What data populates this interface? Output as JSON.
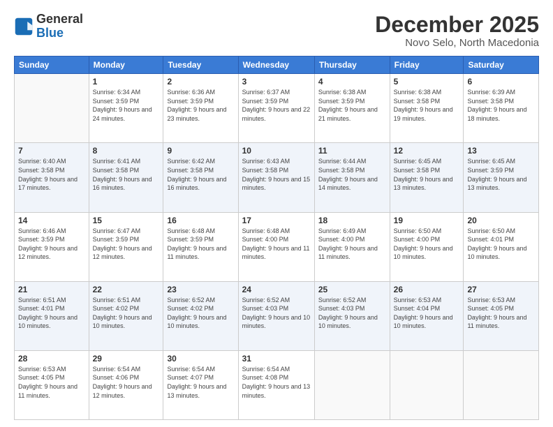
{
  "logo": {
    "general": "General",
    "blue": "Blue"
  },
  "header": {
    "month": "December 2025",
    "location": "Novo Selo, North Macedonia"
  },
  "weekdays": [
    "Sunday",
    "Monday",
    "Tuesday",
    "Wednesday",
    "Thursday",
    "Friday",
    "Saturday"
  ],
  "weeks": [
    [
      {
        "day": "",
        "sunrise": "",
        "sunset": "",
        "daylight": ""
      },
      {
        "day": "1",
        "sunrise": "Sunrise: 6:34 AM",
        "sunset": "Sunset: 3:59 PM",
        "daylight": "Daylight: 9 hours and 24 minutes."
      },
      {
        "day": "2",
        "sunrise": "Sunrise: 6:36 AM",
        "sunset": "Sunset: 3:59 PM",
        "daylight": "Daylight: 9 hours and 23 minutes."
      },
      {
        "day": "3",
        "sunrise": "Sunrise: 6:37 AM",
        "sunset": "Sunset: 3:59 PM",
        "daylight": "Daylight: 9 hours and 22 minutes."
      },
      {
        "day": "4",
        "sunrise": "Sunrise: 6:38 AM",
        "sunset": "Sunset: 3:59 PM",
        "daylight": "Daylight: 9 hours and 21 minutes."
      },
      {
        "day": "5",
        "sunrise": "Sunrise: 6:38 AM",
        "sunset": "Sunset: 3:58 PM",
        "daylight": "Daylight: 9 hours and 19 minutes."
      },
      {
        "day": "6",
        "sunrise": "Sunrise: 6:39 AM",
        "sunset": "Sunset: 3:58 PM",
        "daylight": "Daylight: 9 hours and 18 minutes."
      }
    ],
    [
      {
        "day": "7",
        "sunrise": "Sunrise: 6:40 AM",
        "sunset": "Sunset: 3:58 PM",
        "daylight": "Daylight: 9 hours and 17 minutes."
      },
      {
        "day": "8",
        "sunrise": "Sunrise: 6:41 AM",
        "sunset": "Sunset: 3:58 PM",
        "daylight": "Daylight: 9 hours and 16 minutes."
      },
      {
        "day": "9",
        "sunrise": "Sunrise: 6:42 AM",
        "sunset": "Sunset: 3:58 PM",
        "daylight": "Daylight: 9 hours and 16 minutes."
      },
      {
        "day": "10",
        "sunrise": "Sunrise: 6:43 AM",
        "sunset": "Sunset: 3:58 PM",
        "daylight": "Daylight: 9 hours and 15 minutes."
      },
      {
        "day": "11",
        "sunrise": "Sunrise: 6:44 AM",
        "sunset": "Sunset: 3:58 PM",
        "daylight": "Daylight: 9 hours and 14 minutes."
      },
      {
        "day": "12",
        "sunrise": "Sunrise: 6:45 AM",
        "sunset": "Sunset: 3:58 PM",
        "daylight": "Daylight: 9 hours and 13 minutes."
      },
      {
        "day": "13",
        "sunrise": "Sunrise: 6:45 AM",
        "sunset": "Sunset: 3:59 PM",
        "daylight": "Daylight: 9 hours and 13 minutes."
      }
    ],
    [
      {
        "day": "14",
        "sunrise": "Sunrise: 6:46 AM",
        "sunset": "Sunset: 3:59 PM",
        "daylight": "Daylight: 9 hours and 12 minutes."
      },
      {
        "day": "15",
        "sunrise": "Sunrise: 6:47 AM",
        "sunset": "Sunset: 3:59 PM",
        "daylight": "Daylight: 9 hours and 12 minutes."
      },
      {
        "day": "16",
        "sunrise": "Sunrise: 6:48 AM",
        "sunset": "Sunset: 3:59 PM",
        "daylight": "Daylight: 9 hours and 11 minutes."
      },
      {
        "day": "17",
        "sunrise": "Sunrise: 6:48 AM",
        "sunset": "Sunset: 4:00 PM",
        "daylight": "Daylight: 9 hours and 11 minutes."
      },
      {
        "day": "18",
        "sunrise": "Sunrise: 6:49 AM",
        "sunset": "Sunset: 4:00 PM",
        "daylight": "Daylight: 9 hours and 11 minutes."
      },
      {
        "day": "19",
        "sunrise": "Sunrise: 6:50 AM",
        "sunset": "Sunset: 4:00 PM",
        "daylight": "Daylight: 9 hours and 10 minutes."
      },
      {
        "day": "20",
        "sunrise": "Sunrise: 6:50 AM",
        "sunset": "Sunset: 4:01 PM",
        "daylight": "Daylight: 9 hours and 10 minutes."
      }
    ],
    [
      {
        "day": "21",
        "sunrise": "Sunrise: 6:51 AM",
        "sunset": "Sunset: 4:01 PM",
        "daylight": "Daylight: 9 hours and 10 minutes."
      },
      {
        "day": "22",
        "sunrise": "Sunrise: 6:51 AM",
        "sunset": "Sunset: 4:02 PM",
        "daylight": "Daylight: 9 hours and 10 minutes."
      },
      {
        "day": "23",
        "sunrise": "Sunrise: 6:52 AM",
        "sunset": "Sunset: 4:02 PM",
        "daylight": "Daylight: 9 hours and 10 minutes."
      },
      {
        "day": "24",
        "sunrise": "Sunrise: 6:52 AM",
        "sunset": "Sunset: 4:03 PM",
        "daylight": "Daylight: 9 hours and 10 minutes."
      },
      {
        "day": "25",
        "sunrise": "Sunrise: 6:52 AM",
        "sunset": "Sunset: 4:03 PM",
        "daylight": "Daylight: 9 hours and 10 minutes."
      },
      {
        "day": "26",
        "sunrise": "Sunrise: 6:53 AM",
        "sunset": "Sunset: 4:04 PM",
        "daylight": "Daylight: 9 hours and 10 minutes."
      },
      {
        "day": "27",
        "sunrise": "Sunrise: 6:53 AM",
        "sunset": "Sunset: 4:05 PM",
        "daylight": "Daylight: 9 hours and 11 minutes."
      }
    ],
    [
      {
        "day": "28",
        "sunrise": "Sunrise: 6:53 AM",
        "sunset": "Sunset: 4:05 PM",
        "daylight": "Daylight: 9 hours and 11 minutes."
      },
      {
        "day": "29",
        "sunrise": "Sunrise: 6:54 AM",
        "sunset": "Sunset: 4:06 PM",
        "daylight": "Daylight: 9 hours and 12 minutes."
      },
      {
        "day": "30",
        "sunrise": "Sunrise: 6:54 AM",
        "sunset": "Sunset: 4:07 PM",
        "daylight": "Daylight: 9 hours and 13 minutes."
      },
      {
        "day": "31",
        "sunrise": "Sunrise: 6:54 AM",
        "sunset": "Sunset: 4:08 PM",
        "daylight": "Daylight: 9 hours and 13 minutes."
      },
      {
        "day": "",
        "sunrise": "",
        "sunset": "",
        "daylight": ""
      },
      {
        "day": "",
        "sunrise": "",
        "sunset": "",
        "daylight": ""
      },
      {
        "day": "",
        "sunrise": "",
        "sunset": "",
        "daylight": ""
      }
    ]
  ]
}
